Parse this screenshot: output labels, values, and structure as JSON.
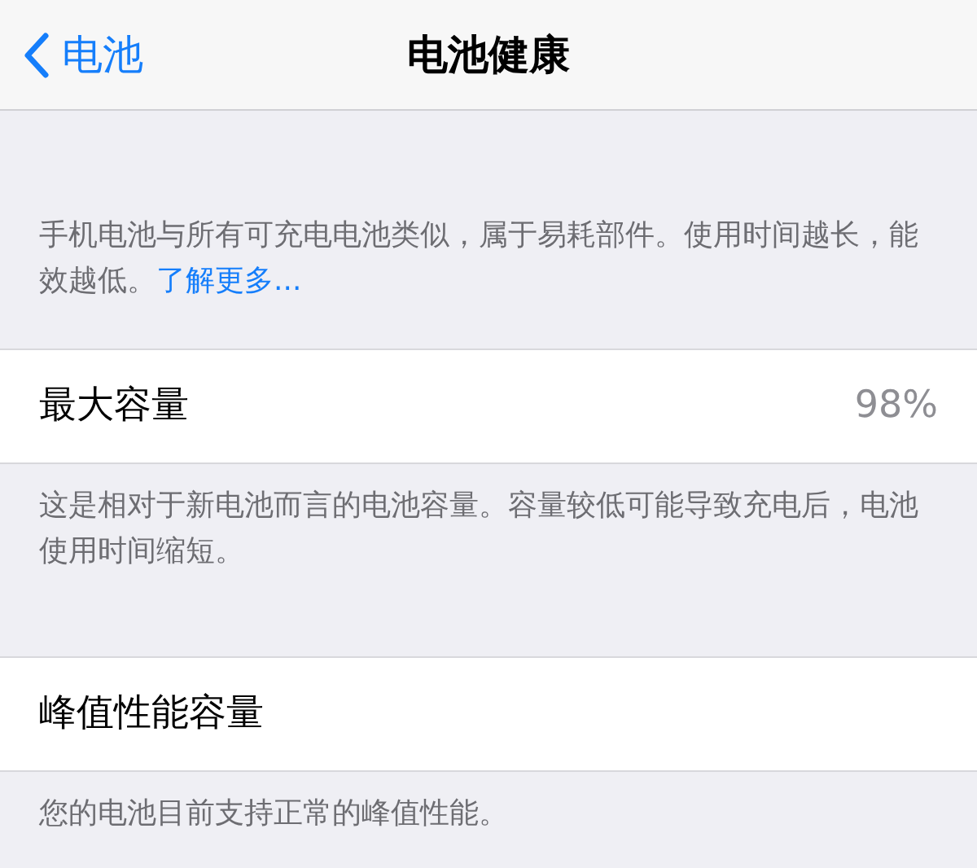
{
  "nav_bar": {
    "back_label": "电池",
    "title": "电池健康"
  },
  "intro": {
    "text": "手机电池与所有可充电电池类似，属于易耗部件。使用时间越长，能效越低。",
    "link": "了解更多..."
  },
  "sections": [
    {
      "label": "最大容量",
      "value": "98%",
      "footer": "这是相对于新电池而言的电池容量。容量较低可能导致充电后，电池使用时间缩短。"
    },
    {
      "label": "峰值性能容量",
      "footer": "您的电池目前支持正常的峰值性能。"
    }
  ]
}
